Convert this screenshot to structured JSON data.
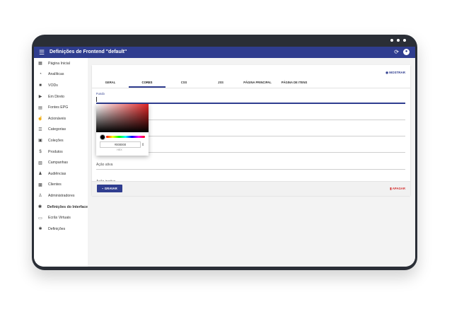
{
  "app": {
    "title": "Definições de Frontend \"default\""
  },
  "sidebar": {
    "items": [
      {
        "label": "Página Inicial",
        "icon": "home-icon",
        "glyph": "▦"
      },
      {
        "label": "Analíticas",
        "icon": "analytics-icon",
        "glyph": "◔"
      },
      {
        "label": "VODs",
        "icon": "video-icon",
        "glyph": "■"
      },
      {
        "label": "Em Direto",
        "icon": "live-icon",
        "glyph": "▶"
      },
      {
        "label": "Fontes EPG",
        "icon": "epg-icon",
        "glyph": "▤"
      },
      {
        "label": "Acionáveis",
        "icon": "actionable-icon",
        "glyph": "☝"
      },
      {
        "label": "Categorias",
        "icon": "list-icon",
        "glyph": "☰"
      },
      {
        "label": "Coleções",
        "icon": "collection-icon",
        "glyph": "▣"
      },
      {
        "label": "Produtos",
        "icon": "dollar-icon",
        "glyph": "$"
      },
      {
        "label": "Campanhas",
        "icon": "campaign-icon",
        "glyph": "▧"
      },
      {
        "label": "Audiências",
        "icon": "people-icon",
        "glyph": "♟"
      },
      {
        "label": "Clientes",
        "icon": "client-icon",
        "glyph": "▩"
      },
      {
        "label": "Administradores",
        "icon": "admin-icon",
        "glyph": "♙"
      },
      {
        "label": "Definições do Interface",
        "icon": "gear-icon",
        "glyph": "✱"
      },
      {
        "label": "Ecrãs Virtuais",
        "icon": "screen-icon",
        "glyph": "▭"
      },
      {
        "label": "Definições",
        "icon": "settings-icon",
        "glyph": "✱"
      }
    ]
  },
  "toolbar": {
    "mostrar_label": "MOSTRAR"
  },
  "tabs": [
    "GERAL",
    "CORES",
    "CSS",
    "JSS",
    "PÁGINA PRINCIPAL",
    "PÁGINA DE ITENS"
  ],
  "form": {
    "fundo_label": "Fundo",
    "acao_ativa_label": "Ação ativa",
    "acao_inativa_label": "Ação inativa"
  },
  "picker": {
    "hex_value": "#000000",
    "hex_label": "HEX"
  },
  "footer": {
    "save_label": "GRAVAR",
    "delete_label": "APAGAR"
  },
  "colors": {
    "primary": "#2f3d8f",
    "danger": "#d32f2f"
  }
}
